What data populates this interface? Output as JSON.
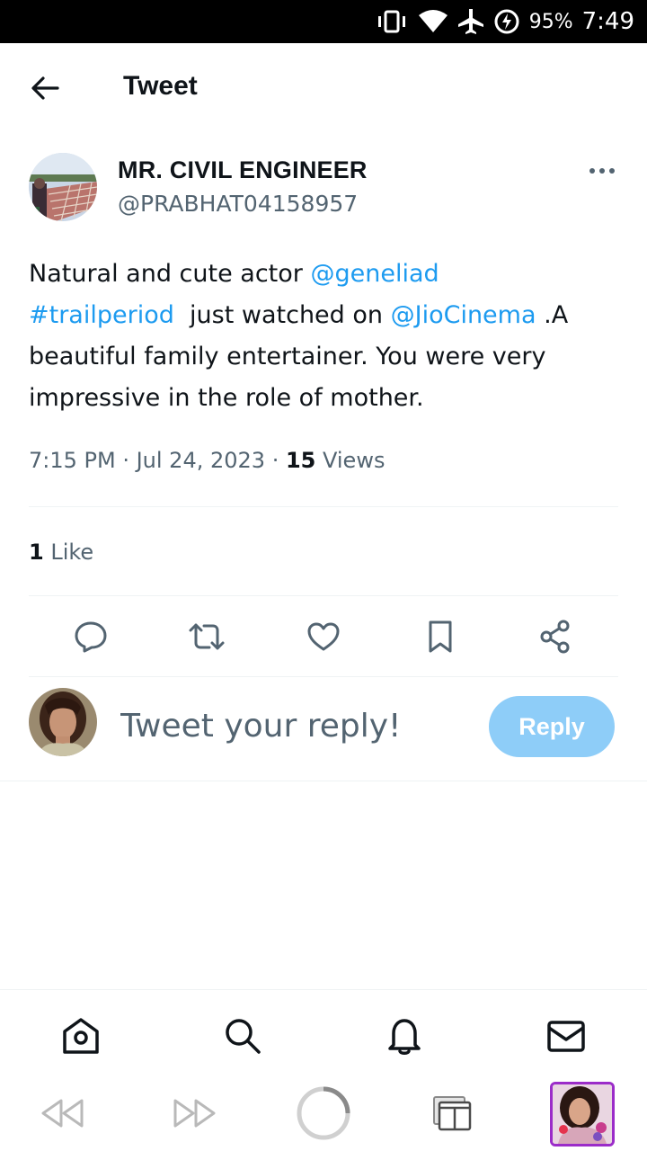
{
  "status_bar": {
    "battery": "95%",
    "time": "7:49",
    "icons": [
      "vibrate-icon",
      "wifi-icon",
      "airplane-icon",
      "battery-charging-icon"
    ]
  },
  "header": {
    "title": "Tweet",
    "back_icon": "arrow-left-icon"
  },
  "tweet": {
    "author_name": "MR. CIVIL ENGINEER",
    "author_handle": "@PRABHAT04158957",
    "text_parts": {
      "p1": "Natural and cute actor ",
      "mention1": "@geneliad",
      "hashtag": "#trailperiod",
      "p2": "  just watched on ",
      "mention2": "@JioCinema",
      "p3": " .A beautiful family entertainer. You were very impressive in the role of mother."
    },
    "time": "7:15 PM",
    "date": "Jul 24, 2023",
    "views_count": "15",
    "views_label": "Views",
    "likes_count": "1",
    "likes_label": "Like"
  },
  "actions": [
    "reply-icon",
    "retweet-icon",
    "like-icon",
    "bookmark-icon",
    "share-icon"
  ],
  "reply_box": {
    "placeholder": "Tweet your reply!",
    "button_label": "Reply"
  },
  "bottom_nav": [
    "home-icon",
    "search-icon",
    "notifications-icon",
    "messages-icon"
  ],
  "system_bar": [
    "rewind-icon",
    "fast-forward-icon",
    "loading-spinner-icon",
    "tabs-icon",
    "app-thumbnail"
  ],
  "colors": {
    "link": "#1d9bf0",
    "secondary_text": "#536471",
    "reply_button": "#8ecdf8",
    "divider": "#eff3f4"
  }
}
